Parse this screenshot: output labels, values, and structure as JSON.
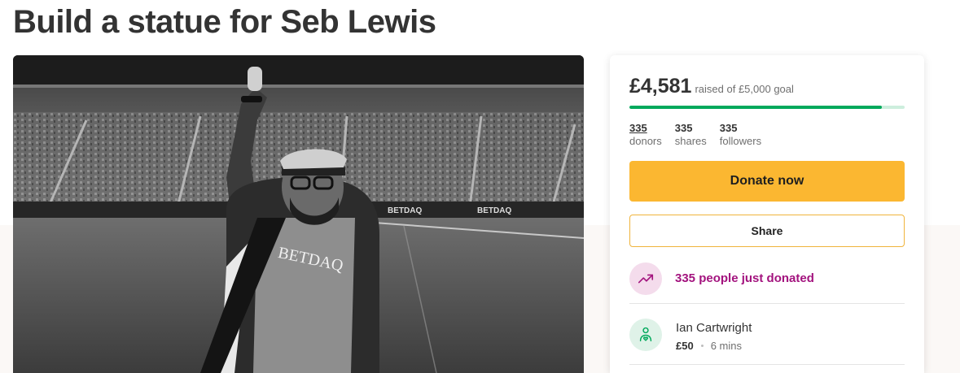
{
  "campaign": {
    "title": "Build a statue for Seb Lewis"
  },
  "hero_image": {
    "alt": "Black and white photo of a fan waving in a football stadium",
    "shirt_text": "BETDAQ",
    "board_text": "BETDAQ"
  },
  "donation_card": {
    "raised_amount": "£4,581",
    "raised_of": "raised of £5,000 goal",
    "progress_fraction": 0.9162,
    "stats": [
      {
        "value": "335",
        "label": "donors"
      },
      {
        "value": "335",
        "label": "shares"
      },
      {
        "value": "335",
        "label": "followers"
      }
    ],
    "donate_label": "Donate now",
    "share_label": "Share",
    "trend_text": "335 people just donated",
    "recent_donation": {
      "name": "Ian Cartwright",
      "amount": "£50",
      "time": "6 mins"
    }
  },
  "colors": {
    "accent_green": "#02a95c",
    "donate_yellow": "#fbb731",
    "trend_purple": "#a3137e"
  },
  "icons": {
    "trend": "trending-up-icon",
    "donor": "heart-hand-icon"
  }
}
